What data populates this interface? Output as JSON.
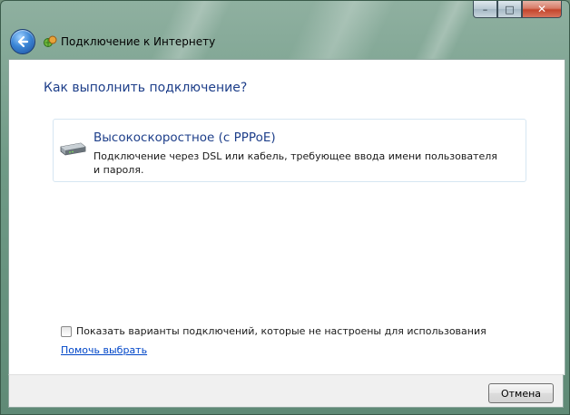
{
  "window": {
    "title": "Подключение к Интернету",
    "caption_buttons": {
      "minimize": "–",
      "maximize": "□",
      "close": "✕"
    }
  },
  "main": {
    "heading": "Как выполнить подключение?",
    "option": {
      "title": "Высокоскоростное (с PPPoE)",
      "description": "Подключение через DSL или кабель, требующее ввода имени пользователя и пароля."
    },
    "checkbox_label": "Показать варианты подключений, которые не настроены для использования",
    "help_link": "Помочь выбрать"
  },
  "footer": {
    "cancel_label": "Отмена"
  }
}
